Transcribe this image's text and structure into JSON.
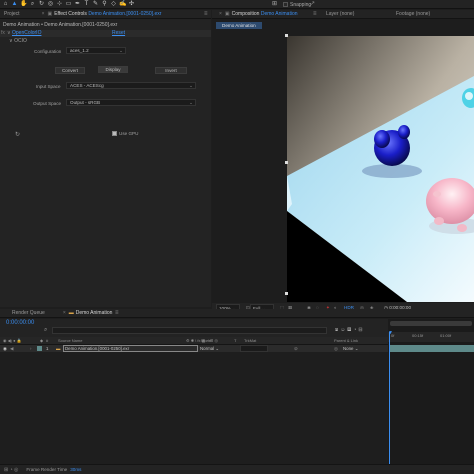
{
  "toolbar": {
    "tools": [
      "home-icon",
      "selection-icon",
      "hand-icon",
      "zoom-icon",
      "rotate-icon",
      "camera-orbit-icon",
      "pan-behind-icon",
      "rectangle-icon",
      "pen-icon",
      "type-icon",
      "brush-icon",
      "clone-stamp-icon",
      "eraser-icon",
      "roto-brush-icon",
      "puppet-icon"
    ],
    "snapping_label": "Snapping"
  },
  "effect_panel": {
    "project_tab": "Project",
    "effect_tab_prefix": "Effect Controls",
    "effect_tab_file": "Demo Animation.[0001-0250].exr",
    "header_text": "Demo Animation • Demo Animation.[0001-0250].exr",
    "effect_name": "OpenColorIO",
    "reset_label": "Reset",
    "ocio_label": "OCIO",
    "configuration_label": "Configuration",
    "configuration_value": "aces_1.2",
    "convert_label": "Convert",
    "display_label": "Display",
    "invert_label": "Invert",
    "input_space_label": "Input Space",
    "input_space_value": "ACES - ACEScg",
    "output_space_label": "Output Space",
    "output_space_value": "Output - sRGB",
    "use_gpu_label": "Use GPU"
  },
  "comp_panel": {
    "comp_tab_prefix": "Composition",
    "comp_tab_name": "Demo Animation",
    "layer_label": "Layer",
    "layer_value": "(none)",
    "footage_label": "Footage",
    "footage_value": "(none)",
    "breadcrumb": "Demo Animation",
    "zoom": "100%",
    "resolution": "Full",
    "hdr_label": "HDR",
    "timecode": "0:00:00:00"
  },
  "timeline": {
    "render_queue_tab": "Render Queue",
    "comp_tab": "Demo Animation",
    "timecode": "0:00:00:00",
    "search_placeholder": "",
    "col_source_name": "Source Name",
    "col_mode": "Mode",
    "col_t": "T",
    "col_trkmat": "TrkMat",
    "col_parent": "Parent & Link",
    "layer_number": "1",
    "layer_name": "Demo Animation.[0001-0250].exr",
    "layer_mode": "Normal",
    "layer_parent": "None",
    "ruler_marks": [
      "0f",
      "00:15f",
      "01:00f"
    ],
    "frame_render_label": "Frame Render Time",
    "frame_render_value": "30ms"
  },
  "colors": {
    "accent": "#3b8ef0",
    "panel_bg": "#232323",
    "layer_bar": "#5e8a8a"
  }
}
